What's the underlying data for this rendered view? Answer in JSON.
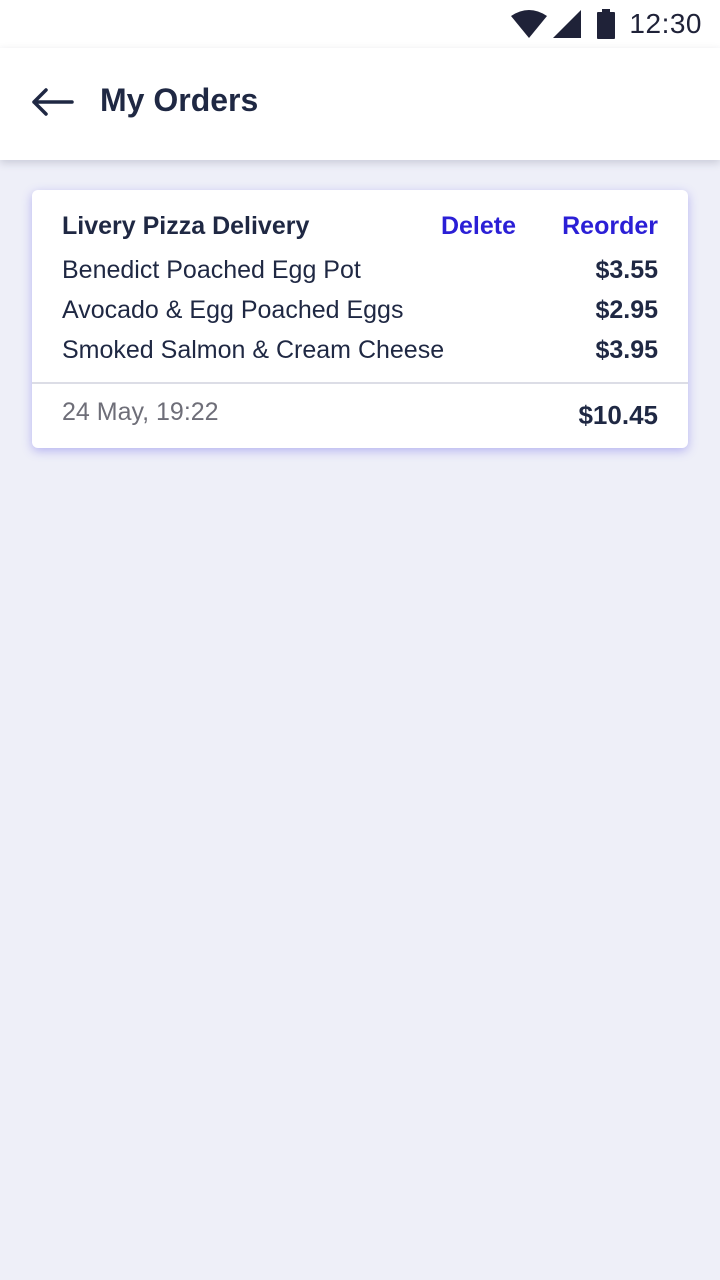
{
  "status_bar": {
    "time": "12:30",
    "icons": [
      "wifi-icon",
      "signal-icon",
      "battery-icon"
    ]
  },
  "app_bar": {
    "back_icon": "arrow-left-icon",
    "title": "My Orders"
  },
  "orders": [
    {
      "restaurant": "Livery Pizza Delivery",
      "delete_label": "Delete",
      "reorder_label": "Reorder",
      "items": [
        {
          "name": "Benedict Poached Egg Pot",
          "price": "$3.55"
        },
        {
          "name": "Avocado & Egg Poached Eggs",
          "price": "$2.95"
        },
        {
          "name": "Smoked Salmon & Cream Cheese",
          "price": "$3.95"
        }
      ],
      "date": "24 May, 19:22",
      "total": "$10.45"
    }
  ],
  "colors": {
    "background": "#eeeff8",
    "text_primary": "#1f2843",
    "accent": "#2b1fd6",
    "text_secondary": "#6e6e78",
    "card_shadow": "#5048e6"
  }
}
